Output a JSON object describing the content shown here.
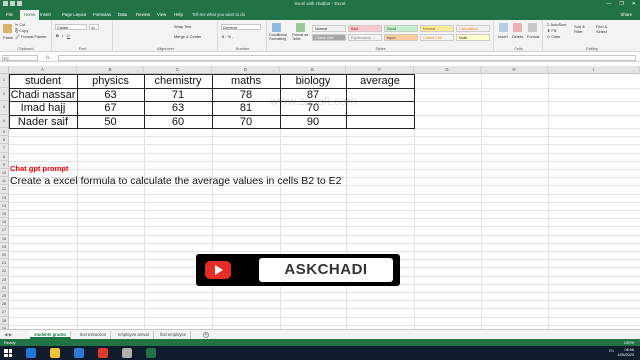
{
  "window": {
    "title": "excel with chatbot - Excel",
    "controls": [
      "—",
      "❐",
      "✕"
    ]
  },
  "ribbon_tabs": [
    "File",
    "Home",
    "Page Layout",
    "Formulas",
    "Data",
    "Review",
    "View",
    "Help"
  ],
  "tell_me": "Tell me what you want to do",
  "share": "Share",
  "ribbon": {
    "clipboard": {
      "cut": "Cut",
      "copy": "Copy",
      "format_painter": "Format Painter",
      "paste": "Paste",
      "label": "Clipboard"
    },
    "font": {
      "name": "Calibri",
      "size": "11",
      "label": "Font"
    },
    "alignment": {
      "wrap": "Wrap Text",
      "merge": "Merge & Center",
      "label": "Alignment"
    },
    "number": {
      "format": "General",
      "label": "Number"
    },
    "conditional": "Conditional Formatting",
    "format_table": "Format as Table",
    "styles": {
      "label": "Styles",
      "cells": [
        {
          "text": "Normal",
          "bg": "#ffffff",
          "fg": "#000000"
        },
        {
          "text": "Bad",
          "bg": "#ffc7ce",
          "fg": "#9c0006"
        },
        {
          "text": "Good",
          "bg": "#c6efce",
          "fg": "#006100"
        },
        {
          "text": "Neutral",
          "bg": "#ffeb9c",
          "fg": "#9c5700"
        },
        {
          "text": "Calculation",
          "bg": "#f2f2f2",
          "fg": "#fa7d00"
        },
        {
          "text": "Check Cell",
          "bg": "#a5a5a5",
          "fg": "#ffffff"
        },
        {
          "text": "Explanatory ...",
          "bg": "#ffffff",
          "fg": "#7f7f7f"
        },
        {
          "text": "Input",
          "bg": "#ffcc99",
          "fg": "#3f3f76"
        },
        {
          "text": "Linked Cell",
          "bg": "#ffffff",
          "fg": "#fa7d00"
        },
        {
          "text": "Note",
          "bg": "#ffffcc",
          "fg": "#000000"
        }
      ]
    },
    "cells": {
      "insert": "Insert",
      "delete": "Delete",
      "format": "Format",
      "label": "Cells"
    },
    "editing": {
      "autosum": "AutoSum",
      "fill": "Fill",
      "clear": "Clear",
      "sort": "Sort & Filter",
      "find": "Find & Select",
      "label": "Editing"
    }
  },
  "formula_bar": {
    "name_box": "F2",
    "fx": "fx",
    "content": ""
  },
  "columns": [
    "A",
    "B",
    "C",
    "D",
    "E",
    "F",
    "G",
    "H",
    "I"
  ],
  "rows": [
    "1",
    "2",
    "3",
    "4",
    "5",
    "6",
    "7",
    "8",
    "9",
    "10",
    "11",
    "12",
    "13",
    "14",
    "15",
    "16",
    "17",
    "18",
    "19",
    "20",
    "21",
    "22",
    "23",
    "24",
    "25",
    "26",
    "27",
    "28",
    "29",
    "30",
    "31"
  ],
  "table": {
    "headers": [
      "student",
      "physics",
      "chemistry",
      "maths",
      "biology",
      "average"
    ],
    "rows": [
      [
        "Chadi nassar",
        "63",
        "71",
        "78",
        "87",
        ""
      ],
      [
        "Imad hajj",
        "67",
        "63",
        "81",
        "70",
        ""
      ],
      [
        "Nader saif",
        "50",
        "60",
        "70",
        "90",
        ""
      ]
    ]
  },
  "prompt_label": "Chat gpt prompt",
  "prompt_text": "Create a excel formula to calculate the average values in cells B2 to E2",
  "watermark": "www.zdsoft.com",
  "banner": "ASKCHADI",
  "sheet_tabs": [
    "students grades",
    "text extraction",
    "employee arrival",
    "find employee"
  ],
  "status": {
    "ready": "Ready",
    "zoom": "100%"
  },
  "taskbar": {
    "time": "08:56",
    "date": "1/05/2023",
    "lang": "EN"
  }
}
